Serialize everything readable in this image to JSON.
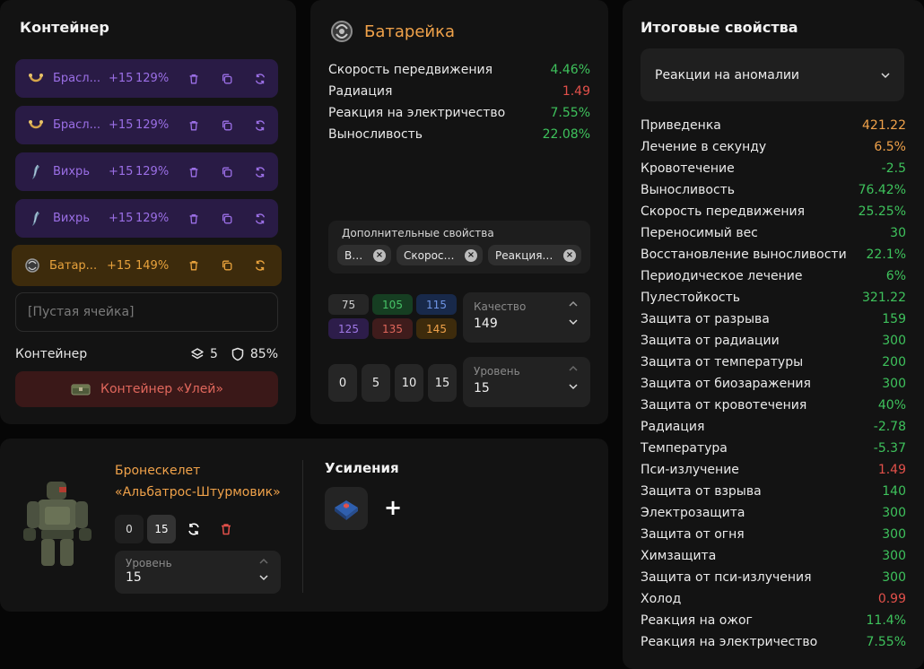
{
  "container": {
    "title": "Контейнер",
    "slots": [
      {
        "name": "Брасл...",
        "level": "+15",
        "percent": "129%",
        "icon": "bracelet-icon",
        "tone": "purple"
      },
      {
        "name": "Брасл...",
        "level": "+15",
        "percent": "129%",
        "icon": "bracelet-icon",
        "tone": "purple"
      },
      {
        "name": "Вихрь",
        "level": "+15",
        "percent": "129%",
        "icon": "whirl-icon",
        "tone": "purple"
      },
      {
        "name": "Вихрь",
        "level": "+15",
        "percent": "129%",
        "icon": "whirl-icon",
        "tone": "purple"
      },
      {
        "name": "Батар...",
        "level": "+15",
        "percent": "149%",
        "icon": "battery-icon",
        "tone": "gold"
      }
    ],
    "empty_slot": "[Пустая ячейка]",
    "footer_label": "Контейнер",
    "capacity": "5",
    "protection": "85%",
    "hive_button": "Контейнер «Улей»"
  },
  "battery": {
    "title": "Батарейка",
    "props": [
      {
        "name": "Скорость передвижения",
        "value": "4.46%",
        "color": "g"
      },
      {
        "name": "Радиация",
        "value": "1.49",
        "color": "r"
      },
      {
        "name": "Реакция на электричество",
        "value": "7.55%",
        "color": "g"
      },
      {
        "name": "Выносливость",
        "value": "22.08%",
        "color": "g"
      }
    ],
    "extra_label": "Дополнительные свойства",
    "chips": [
      "Вы...",
      "Скорость...",
      "Реакция н..."
    ],
    "quality_values": [
      {
        "v": "75",
        "bg": "#262626",
        "fg": "#d0d0d0"
      },
      {
        "v": "105",
        "bg": "#163e22",
        "fg": "#47c467"
      },
      {
        "v": "115",
        "bg": "#18294a",
        "fg": "#6f95e6"
      },
      {
        "v": "125",
        "bg": "#2d1d4a",
        "fg": "#a17ae8"
      },
      {
        "v": "135",
        "bg": "#3f1c1c",
        "fg": "#e0675c"
      },
      {
        "v": "145",
        "bg": "#3d2b0c",
        "fg": "#f0a24a"
      }
    ],
    "quality_label": "Качество",
    "quality_value": "149",
    "level_buttons": [
      "0",
      "5",
      "10",
      "15"
    ],
    "level_label": "Уровень",
    "level_value": "15"
  },
  "armor": {
    "name_line1": "Бронескелет",
    "name_line2": "«Альбатрос-Штурмовик»",
    "level_buttons": [
      "0",
      "15"
    ],
    "level_label": "Уровень",
    "level_value": "15",
    "boosts_title": "Усиления",
    "add_symbol": "+"
  },
  "totals": {
    "title": "Итоговые свойства",
    "dropdown": "Реакции на аномалии",
    "rows": [
      {
        "name": "Приведенка",
        "value": "421.22",
        "color": "o"
      },
      {
        "name": "Лечение в секунду",
        "value": "6.5%",
        "color": "o"
      },
      {
        "name": "Кровотечение",
        "value": "-2.5",
        "color": "g"
      },
      {
        "name": "Выносливость",
        "value": "76.42%",
        "color": "g"
      },
      {
        "name": "Скорость передвижения",
        "value": "25.25%",
        "color": "g"
      },
      {
        "name": "Переносимый вес",
        "value": "30",
        "color": "g"
      },
      {
        "name": "Восстановление выносливости",
        "value": "22.1%",
        "color": "g"
      },
      {
        "name": "Периодическое лечение",
        "value": "6%",
        "color": "g"
      },
      {
        "name": "Пулестойкость",
        "value": "321.22",
        "color": "g"
      },
      {
        "name": "Защита от разрыва",
        "value": "159",
        "color": "g"
      },
      {
        "name": "Защита от радиации",
        "value": "300",
        "color": "g"
      },
      {
        "name": "Защита от температуры",
        "value": "200",
        "color": "g"
      },
      {
        "name": "Защита от биозаражения",
        "value": "300",
        "color": "g"
      },
      {
        "name": "Защита от кровотечения",
        "value": "40%",
        "color": "g"
      },
      {
        "name": "Радиация",
        "value": "-2.78",
        "color": "g"
      },
      {
        "name": "Температура",
        "value": "-5.37",
        "color": "g"
      },
      {
        "name": "Пси-излучение",
        "value": "1.49",
        "color": "r"
      },
      {
        "name": "Защита от взрыва",
        "value": "140",
        "color": "g"
      },
      {
        "name": "Электрозащита",
        "value": "300",
        "color": "g"
      },
      {
        "name": "Защита от огня",
        "value": "300",
        "color": "g"
      },
      {
        "name": "Химзащита",
        "value": "300",
        "color": "g"
      },
      {
        "name": "Защита от пси-излучения",
        "value": "300",
        "color": "g"
      },
      {
        "name": "Холод",
        "value": "0.99",
        "color": "r"
      },
      {
        "name": "Реакция на ожог",
        "value": "11.4%",
        "color": "g"
      },
      {
        "name": "Реакция на электричество",
        "value": "7.55%",
        "color": "g"
      }
    ]
  }
}
